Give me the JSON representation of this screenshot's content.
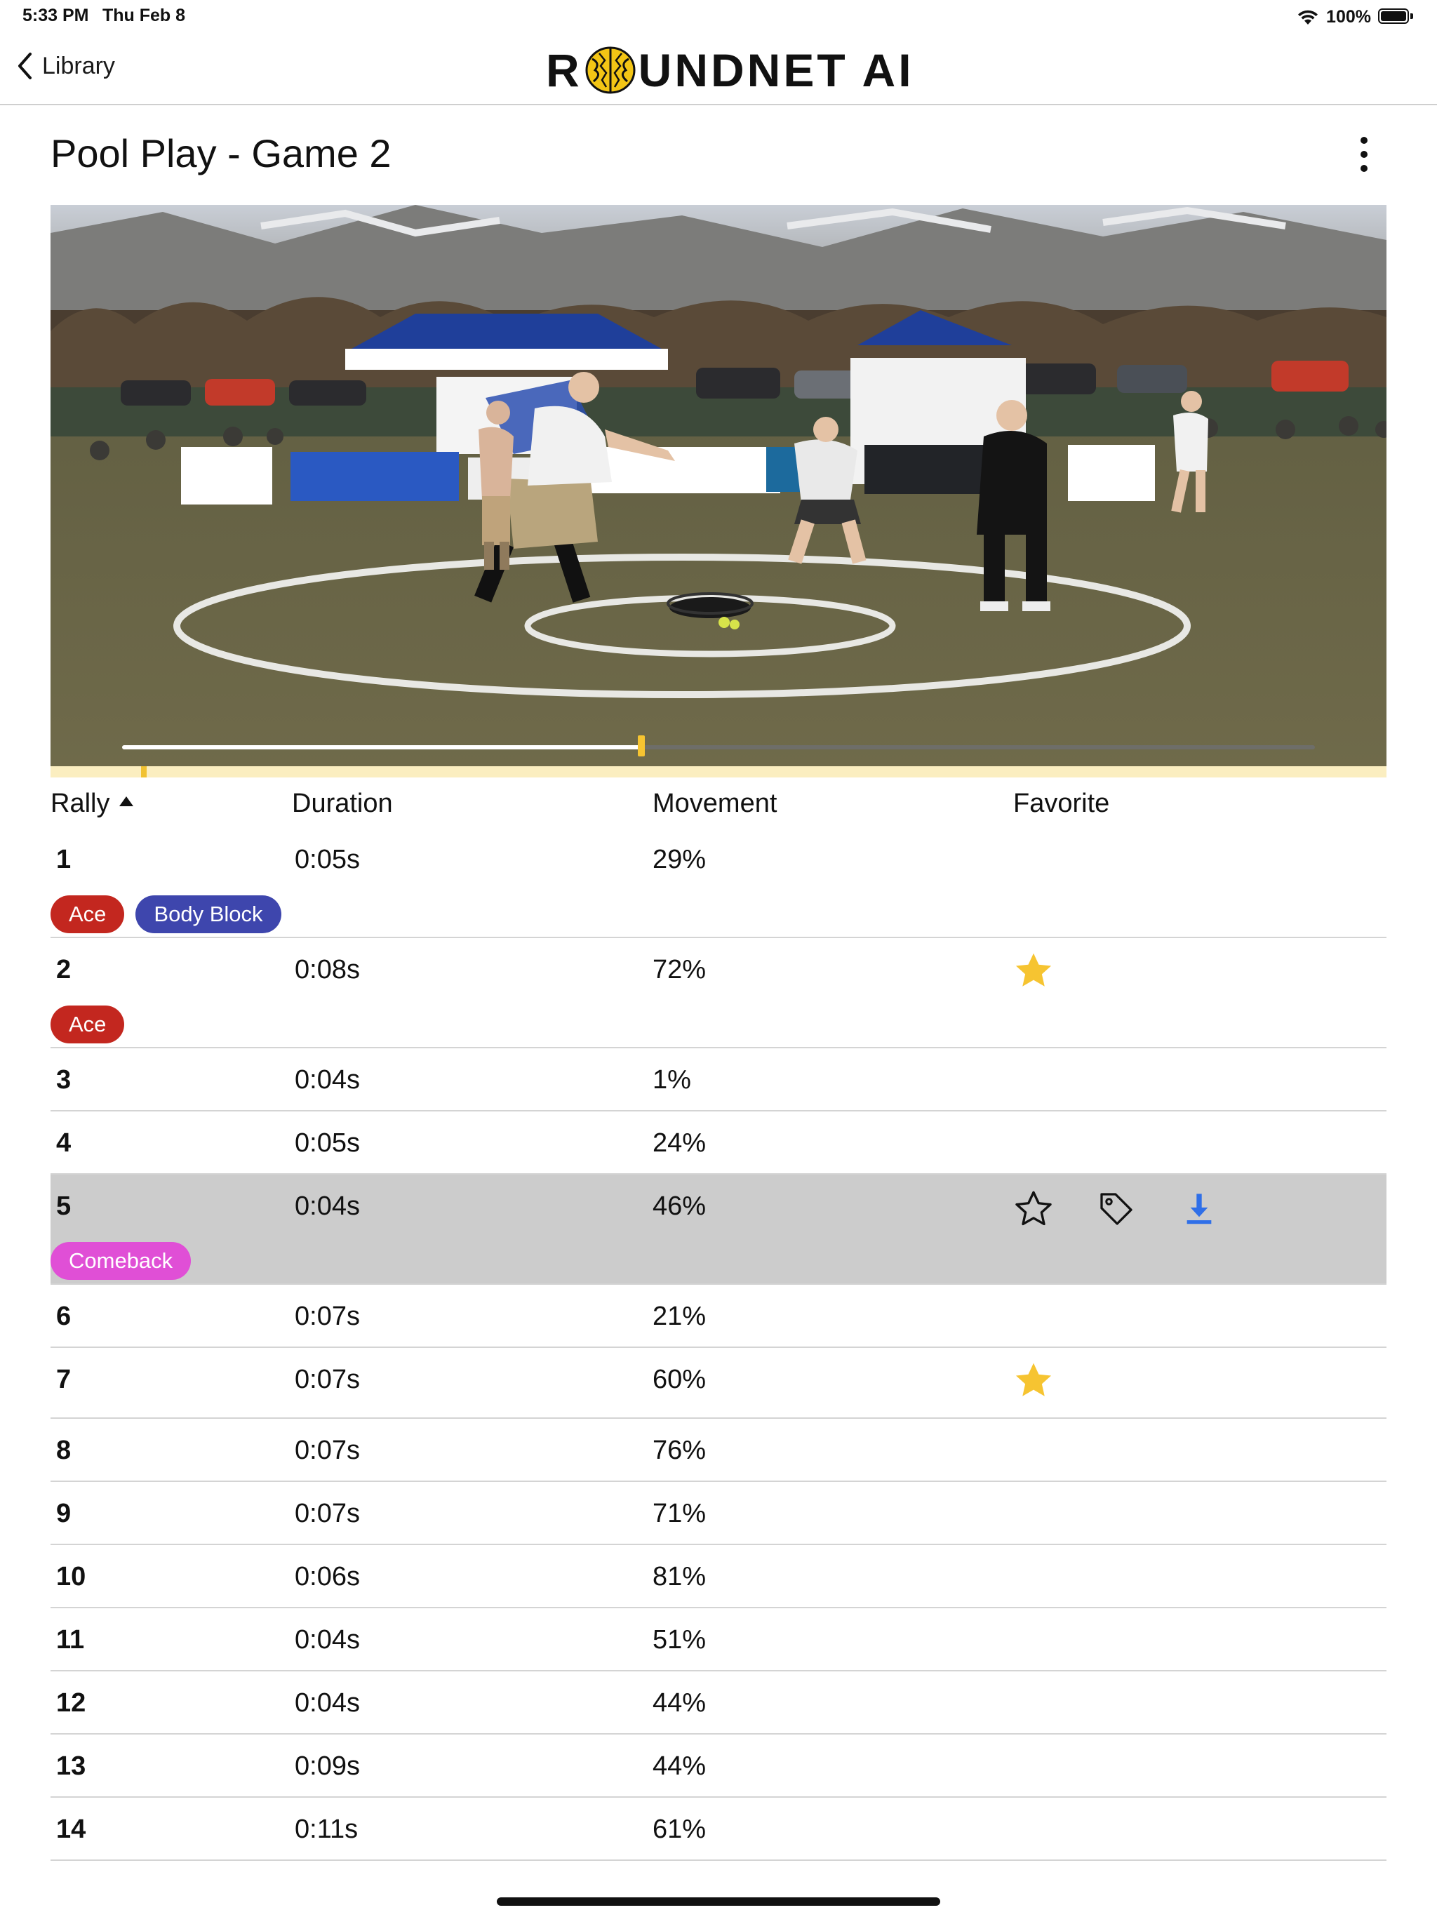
{
  "status_bar": {
    "time": "5:33 PM",
    "date": "Thu Feb 8",
    "battery": "100%"
  },
  "nav": {
    "back_label": "Library",
    "logo_left": "R",
    "logo_right": "UNDNET AI"
  },
  "page": {
    "title": "Pool Play - Game 2"
  },
  "video": {
    "progress": 0.435,
    "timeline_marker": 0.07
  },
  "table": {
    "headers": {
      "rally": "Rally",
      "duration": "Duration",
      "movement": "Movement",
      "favorite": "Favorite"
    },
    "rows": [
      {
        "rally": "1",
        "duration": "0:05s",
        "movement": "29%",
        "favorite": false,
        "tags": [
          {
            "label": "Ace",
            "color": "#c3271f"
          },
          {
            "label": "Body Block",
            "color": "#3e46ad"
          }
        ]
      },
      {
        "rally": "2",
        "duration": "0:08s",
        "movement": "72%",
        "favorite": true,
        "tags": [
          {
            "label": "Ace",
            "color": "#c3271f"
          }
        ]
      },
      {
        "rally": "3",
        "duration": "0:04s",
        "movement": "1%",
        "favorite": false,
        "tags": []
      },
      {
        "rally": "4",
        "duration": "0:05s",
        "movement": "24%",
        "favorite": false,
        "tags": []
      },
      {
        "rally": "5",
        "duration": "0:04s",
        "movement": "46%",
        "favorite": false,
        "selected": true,
        "tags": [
          {
            "label": "Comeback",
            "color": "#e04fd6"
          }
        ]
      },
      {
        "rally": "6",
        "duration": "0:07s",
        "movement": "21%",
        "favorite": false,
        "tags": []
      },
      {
        "rally": "7",
        "duration": "0:07s",
        "movement": "60%",
        "favorite": true,
        "tags": []
      },
      {
        "rally": "8",
        "duration": "0:07s",
        "movement": "76%",
        "favorite": false,
        "tags": []
      },
      {
        "rally": "9",
        "duration": "0:07s",
        "movement": "71%",
        "favorite": false,
        "tags": []
      },
      {
        "rally": "10",
        "duration": "0:06s",
        "movement": "81%",
        "favorite": false,
        "tags": []
      },
      {
        "rally": "11",
        "duration": "0:04s",
        "movement": "51%",
        "favorite": false,
        "tags": []
      },
      {
        "rally": "12",
        "duration": "0:04s",
        "movement": "44%",
        "favorite": false,
        "tags": []
      },
      {
        "rally": "13",
        "duration": "0:09s",
        "movement": "44%",
        "favorite": false,
        "tags": []
      },
      {
        "rally": "14",
        "duration": "0:11s",
        "movement": "61%",
        "favorite": false,
        "tags": []
      }
    ]
  },
  "colors": {
    "star": "#f6c431",
    "download": "#2f6fe8",
    "selected_row": "#cccccc"
  }
}
